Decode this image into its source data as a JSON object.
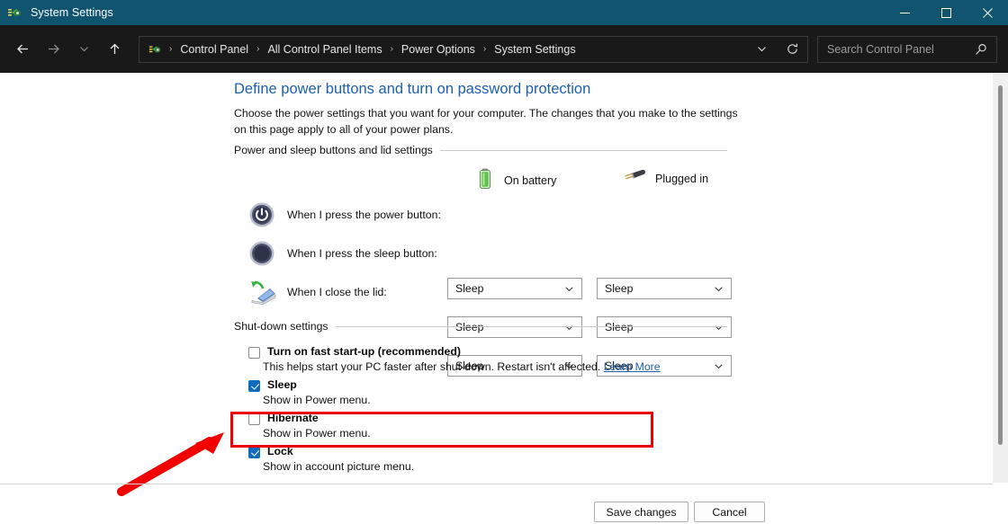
{
  "titlebar": {
    "title": "System Settings",
    "icon": "system-settings-icon",
    "minimize": "minimize-icon",
    "maximize": "maximize-icon",
    "close": "close-icon"
  },
  "toolbar": {
    "back": "back-arrow-icon",
    "forward": "forward-arrow-icon",
    "recent": "chevron-down-icon",
    "up": "up-arrow-icon",
    "breadcrumb": [
      "Control Panel",
      "All Control Panel Items",
      "Power Options",
      "System Settings"
    ],
    "separator": "›",
    "address_chevron": "chevron-down-icon",
    "refresh": "refresh-icon",
    "search": {
      "placeholder": "Search Control Panel",
      "icon": "search-icon"
    }
  },
  "page": {
    "title": "Define power buttons and turn on password protection",
    "description": "Choose the power settings that you want for your computer. The changes that you make to the settings on this page apply to all of your power plans."
  },
  "power_section": {
    "heading": "Power and sleep buttons and lid settings",
    "columns": [
      {
        "label": "On battery",
        "icon": "battery-icon"
      },
      {
        "label": "Plugged in",
        "icon": "power-plug-icon"
      }
    ],
    "rows": [
      {
        "label": "When I press the power button:",
        "icon": "power-button-icon",
        "on_battery": "Sleep",
        "plugged_in": "Sleep"
      },
      {
        "label": "When I press the sleep button:",
        "icon": "sleep-button-icon",
        "on_battery": "Sleep",
        "plugged_in": "Sleep"
      },
      {
        "label": "When I close the lid:",
        "icon": "laptop-lid-icon",
        "on_battery": "Sleep",
        "plugged_in": "Sleep"
      }
    ]
  },
  "shutdown_section": {
    "heading": "Shut-down settings",
    "options": [
      {
        "title": "Turn on fast start-up (recommended)",
        "checked": false,
        "description": "This helps start your PC faster after shut-down. Restart isn't affected.",
        "link": "Learn More"
      },
      {
        "title": "Sleep",
        "checked": true,
        "description": "Show in Power menu.",
        "link": ""
      },
      {
        "title": "Hibernate",
        "checked": false,
        "description": "Show in Power menu.",
        "link": ""
      },
      {
        "title": "Lock",
        "checked": true,
        "description": "Show in account picture menu.",
        "link": ""
      }
    ]
  },
  "footer": {
    "save_label": "Save changes",
    "cancel_label": "Cancel"
  },
  "annotation": {
    "highlight_color": "#ee0000",
    "arrow": "red-arrow-annotation"
  },
  "colors": {
    "titlebar": "#11546f",
    "toolbar": "#191919",
    "link": "#1c5fb0",
    "checkbox_checked": "#0f6cbd"
  }
}
